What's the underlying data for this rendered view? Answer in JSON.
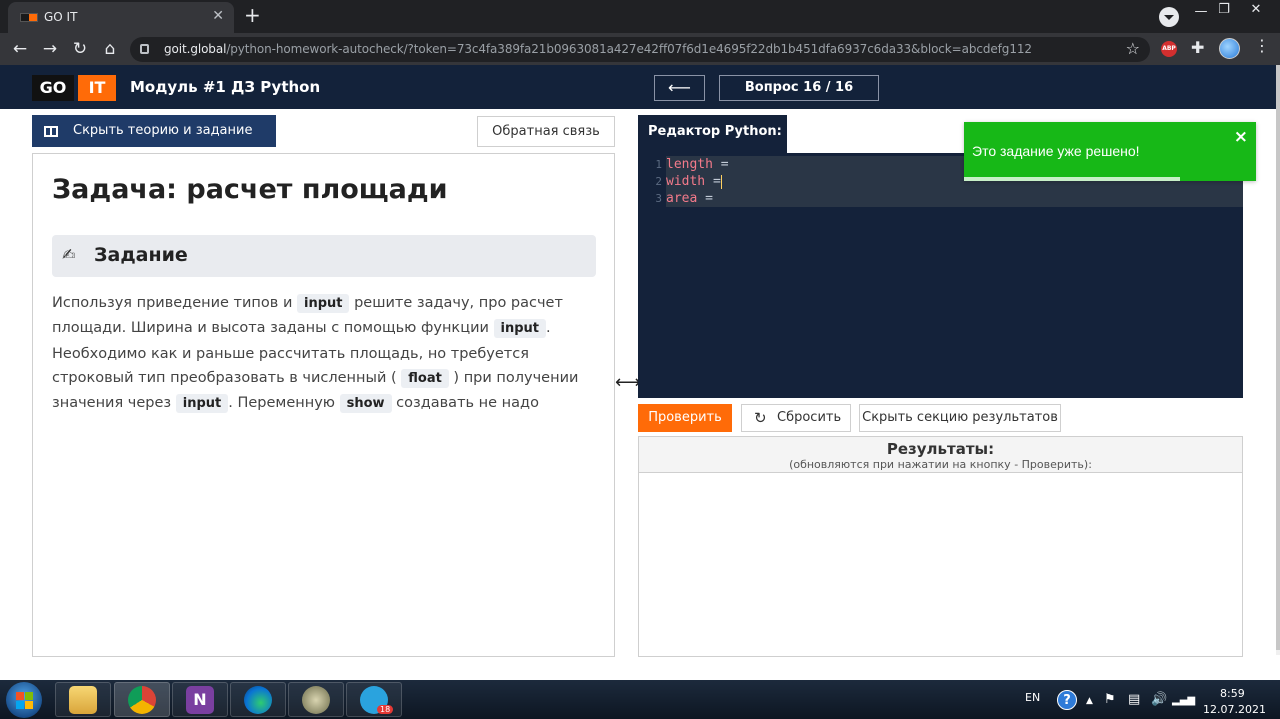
{
  "browser": {
    "tab_title": "GO IT",
    "close_glyph": "✕",
    "new_tab_glyph": "+",
    "url_host": "goit.global",
    "url_path": "/python-homework-autocheck/?token=73c4fa389fa21b0963081a427e42ff07f6d1e4695f22db1b451dfa6937c6da33&block=abcdefg112",
    "abp_label": "ABP"
  },
  "header": {
    "logo_go": "GO",
    "logo_it": "IT",
    "module_title": "Модуль #1 ДЗ Python",
    "back_arrow": "⟵",
    "question_label": "Вопрос 16 / 16"
  },
  "left": {
    "toggle_label": "Скрыть теорию и задание",
    "feedback_label": "Обратная связь",
    "task_title": "Задача: расчет площади",
    "section_title": "Задание",
    "text": {
      "p1": "Используя приведение типов и ",
      "c1": "input",
      "p2": " решите задачу, про расчет площади. Ширина и высота заданы с помощью функции ",
      "c2": "input",
      "p3": ". Необходимо как и раньше рассчитать площадь, но требуется строковый тип преобразовать в численный ( ",
      "c3": "float",
      "p4": " ) при получении значения через ",
      "c4": "input",
      "p5": ". Переменную ",
      "c5": "show",
      "p6": " создавать не надо"
    }
  },
  "resize_glyph": "⟷",
  "editor": {
    "tab_label": "Редактор Python:",
    "lines": [
      {
        "num": "1",
        "var": "length",
        "op": " ="
      },
      {
        "num": "2",
        "var": "width",
        "op": " ="
      },
      {
        "num": "3",
        "var": "area",
        "op": " ="
      }
    ]
  },
  "toast": {
    "message": "Это задание уже решено!",
    "close": "×",
    "progress": 0.74
  },
  "actions": {
    "check_label": "Проверить",
    "reset_label": "Сбросить",
    "reset_icon": "↻",
    "hide_results_label": "Скрыть секцию результатов"
  },
  "results": {
    "title": "Результаты:",
    "subtitle": "(обновляются при нажатии на кнопку - Проверить):"
  },
  "taskbar": {
    "lang": "EN",
    "time": "8:59",
    "date": "12.07.2021",
    "apps": [
      "file-explorer",
      "chrome",
      "onenote",
      "edge",
      "app-icon",
      "telegram"
    ],
    "onenote_letter": "N",
    "telegram_badge": "18",
    "help_glyph": "?"
  }
}
